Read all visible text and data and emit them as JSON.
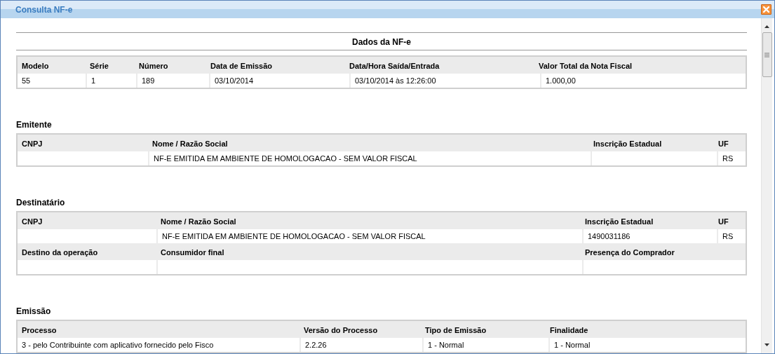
{
  "window": {
    "title": "Consulta NF-e"
  },
  "heading": "Dados da NF-e",
  "sections": [
    {
      "kind": "invoice",
      "rows": [
        {
          "cells": [
            {
              "label": "Modelo",
              "value": "55"
            },
            {
              "label": "Série",
              "value": "1"
            },
            {
              "label": "Número",
              "value": "189"
            },
            {
              "label": "Data de Emissão",
              "value": "03/10/2014"
            },
            {
              "label": "Data/Hora Saída/Entrada",
              "value": "03/10/2014 às 12:26:00"
            },
            {
              "label": "Valor Total da Nota Fiscal",
              "value": "1.000,00"
            }
          ]
        }
      ]
    },
    {
      "kind": "issuer",
      "title": "Emitente",
      "rows": [
        {
          "cells": [
            {
              "label": "CNPJ"
            },
            {
              "label": "Nome / Razão Social",
              "value": "NF-E EMITIDA EM AMBIENTE DE HOMOLOGACAO - SEM VALOR FISCAL"
            },
            {
              "label": "Inscrição Estadual"
            },
            {
              "label": "UF",
              "value": "RS"
            }
          ]
        }
      ]
    },
    {
      "kind": "recipient",
      "title": "Destinatário",
      "rows": [
        {
          "cells": [
            {
              "label": "CNPJ"
            },
            {
              "label": "Nome / Razão Social",
              "value": "NF-E EMITIDA EM AMBIENTE DE HOMOLOGACAO - SEM VALOR FISCAL"
            },
            {
              "label": "Inscrição Estadual",
              "value": "1490031186"
            },
            {
              "label": "UF",
              "value": "RS"
            }
          ]
        },
        {
          "cells": [
            {
              "label": "Destino da operação"
            },
            {
              "label": "Consumidor final"
            },
            {
              "label": "Presença do Comprador"
            }
          ]
        }
      ]
    },
    {
      "kind": "emission",
      "title": "Emissão",
      "rows": [
        {
          "cells": [
            {
              "label": "Processo",
              "value": "3 - pelo Contribuinte com aplicativo fornecido pelo Fisco"
            },
            {
              "label": "Versão do Processo",
              "value": "2.2.26"
            },
            {
              "label": "Tipo de Emissão",
              "value": "1 - Normal"
            },
            {
              "label": "Finalidade",
              "value": "1 - Normal"
            }
          ]
        }
      ]
    }
  ]
}
